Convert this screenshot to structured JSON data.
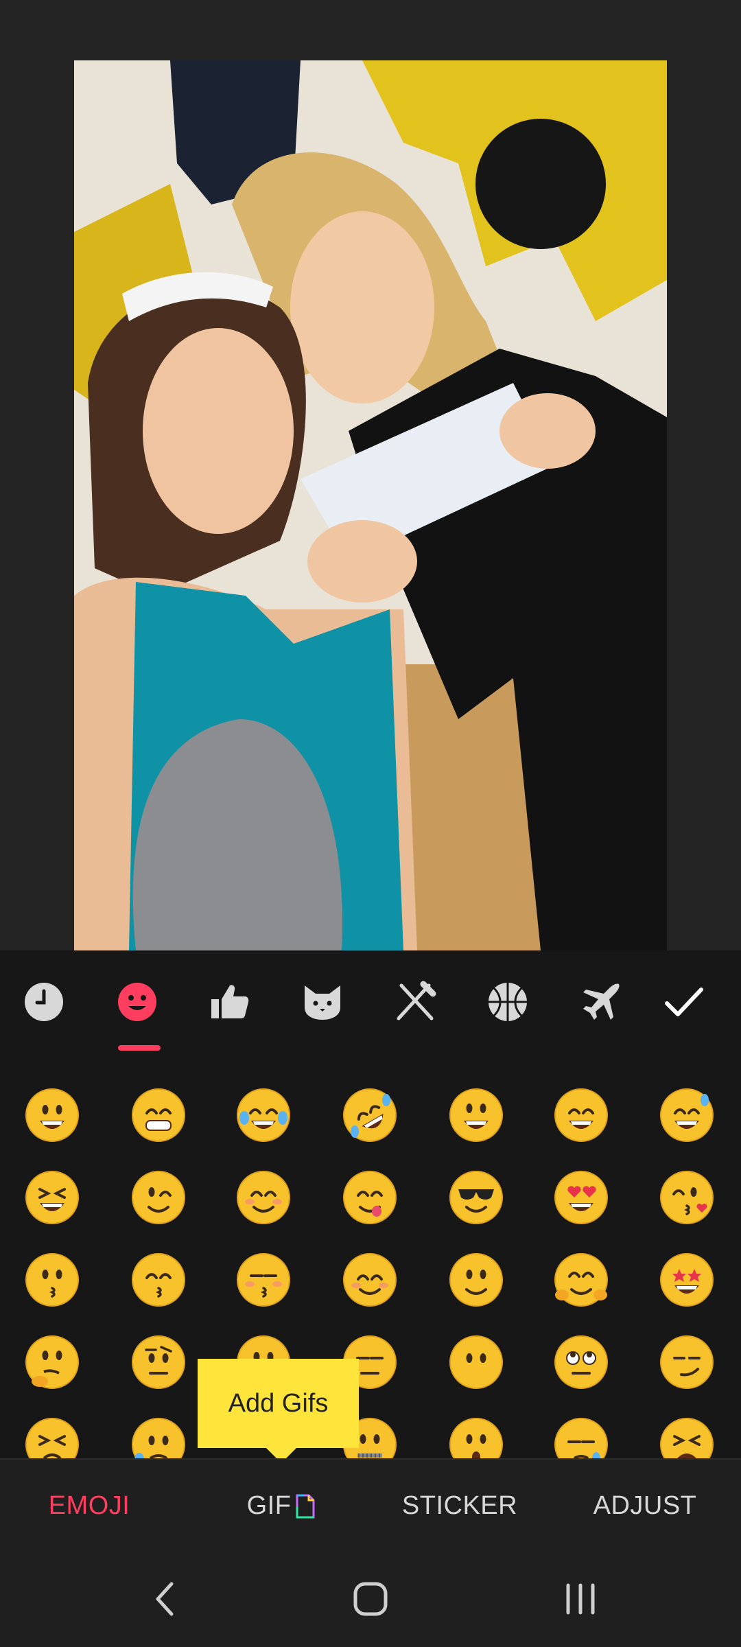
{
  "categories": [
    {
      "name": "recent",
      "icon": "clock-icon",
      "active": false
    },
    {
      "name": "smileys",
      "icon": "smiley-icon",
      "active": true
    },
    {
      "name": "people",
      "icon": "thumbs-up-icon",
      "active": false
    },
    {
      "name": "animals",
      "icon": "cat-icon",
      "active": false
    },
    {
      "name": "food",
      "icon": "fork-knife-icon",
      "active": false
    },
    {
      "name": "activity",
      "icon": "basketball-icon",
      "active": false
    },
    {
      "name": "travel",
      "icon": "airplane-icon",
      "active": false
    }
  ],
  "confirm_icon": "checkmark-icon",
  "emoji_rows": [
    [
      "grinning",
      "beaming",
      "tears-of-joy",
      "rofl",
      "grinning-big-eyes",
      "grinning-smiling-eyes",
      "sweat-smile"
    ],
    [
      "squinting-laugh",
      "wink",
      "blush",
      "yum",
      "sunglasses",
      "heart-eyes",
      "kiss-heart"
    ],
    [
      "kissing",
      "kissing-smiling-eyes",
      "kissing-closed-eyes",
      "relaxed",
      "slight-smile",
      "hugging",
      "star-struck"
    ],
    [
      "thinking",
      "raised-eyebrow",
      "neutral",
      "expressionless",
      "no-mouth",
      "eye-roll",
      "smirk"
    ],
    [
      "persevering",
      "sad-sweat",
      "",
      "zipper-mouth",
      "hushed",
      "sleepy",
      "tired"
    ]
  ],
  "tooltip": {
    "text": "Add Gifs"
  },
  "tabs": {
    "emoji": "EMOJI",
    "gif": "GIF",
    "sticker": "STICKER",
    "adjust": "ADJUST"
  },
  "colors": {
    "accent": "#ff3d5e",
    "tooltip": "#ffe53b",
    "emoji_yellow": "#f7c22b"
  }
}
